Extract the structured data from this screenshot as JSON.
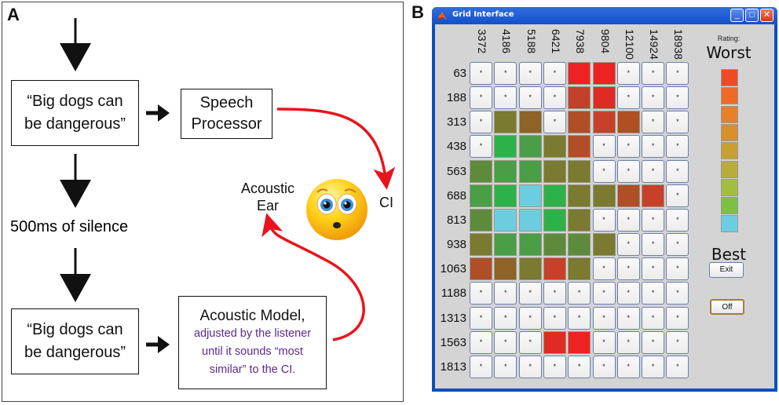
{
  "panel_a": {
    "letter": "A",
    "box1": {
      "line1": "“Big dogs can",
      "line2": "be dangerous”"
    },
    "speech_processor": {
      "line1": "Speech",
      "line2": "Processor"
    },
    "silence_label": "500ms of silence",
    "box2": {
      "line1": "“Big dogs can",
      "line2": "be dangerous”"
    },
    "acoustic_model": {
      "title": "Acoustic Model,",
      "line1": "adjusted by the listener",
      "line2": "until it sounds “most",
      "line3": "similar” to the CI."
    },
    "acoustic_ear": {
      "line1": "Acoustic",
      "line2": "Ear"
    },
    "ci_label": "CI",
    "colors": {
      "arrow_red": "#e8141c",
      "purple_text": "#5b2a8e"
    }
  },
  "panel_b": {
    "letter": "B",
    "window_title": "Grid Interface",
    "columns": [
      "3372",
      "4186",
      "5188",
      "6421",
      "7938",
      "9804",
      "12100",
      "14924",
      "18938"
    ],
    "rows": [
      "63",
      "188",
      "313",
      "438",
      "563",
      "688",
      "813",
      "938",
      "1063",
      "1188",
      "1313",
      "1563",
      "1813"
    ],
    "empty_marker": "*",
    "grid": [
      [
        null,
        null,
        null,
        null,
        "#ee2222",
        "#ee2222",
        null,
        null,
        null
      ],
      [
        null,
        null,
        null,
        null,
        "#c2402a",
        "#e02a26",
        null,
        null,
        null
      ],
      [
        null,
        "#7a7a30",
        "#8f6228",
        null,
        "#b04e28",
        "#c8402a",
        "#b04e24",
        null,
        null
      ],
      [
        null,
        "#2db24a",
        "#4a9e46",
        "#7a7a30",
        "#b04e28",
        null,
        null,
        null,
        null
      ],
      [
        "#5e8a3c",
        "#4a9e46",
        "#4a9e46",
        "#7a7a30",
        "#7a7a30",
        null,
        null,
        null,
        null
      ],
      [
        "#4a9e46",
        "#2db24a",
        "#6ccde0",
        "#2db24a",
        "#7a7a30",
        "#7a7a30",
        "#b04e28",
        "#c8402a",
        null
      ],
      [
        "#5e8a3c",
        "#6ccde0",
        "#6ccde0",
        "#2db24a",
        "#7a7a30",
        null,
        null,
        null,
        null
      ],
      [
        "#7a7a30",
        "#4a9e46",
        "#4a9e46",
        "#5e8a3c",
        "#5e8a3c",
        "#7a7a30",
        null,
        null,
        null
      ],
      [
        "#b04e28",
        "#8f6228",
        "#7a7a30",
        "#c8402a",
        "#7a7a30",
        null,
        null,
        null,
        null
      ],
      [
        null,
        null,
        null,
        null,
        null,
        null,
        null,
        null,
        null
      ],
      [
        null,
        null,
        null,
        null,
        null,
        null,
        null,
        null,
        null
      ],
      [
        null,
        null,
        null,
        "#e02a26",
        "#ee2222",
        null,
        null,
        null,
        null
      ],
      [
        null,
        null,
        null,
        null,
        null,
        null,
        null,
        null,
        null
      ]
    ],
    "rating": {
      "label": "Rating:",
      "worst": "Worst",
      "best": "Best",
      "scale_colors": [
        "#f04a24",
        "#f06a24",
        "#e6802a",
        "#d6902e",
        "#c8a032",
        "#b8ac3a",
        "#a2be3e",
        "#7cc044",
        "#6ccde0"
      ]
    },
    "buttons": {
      "exit": "Exit",
      "off": "Off"
    }
  }
}
